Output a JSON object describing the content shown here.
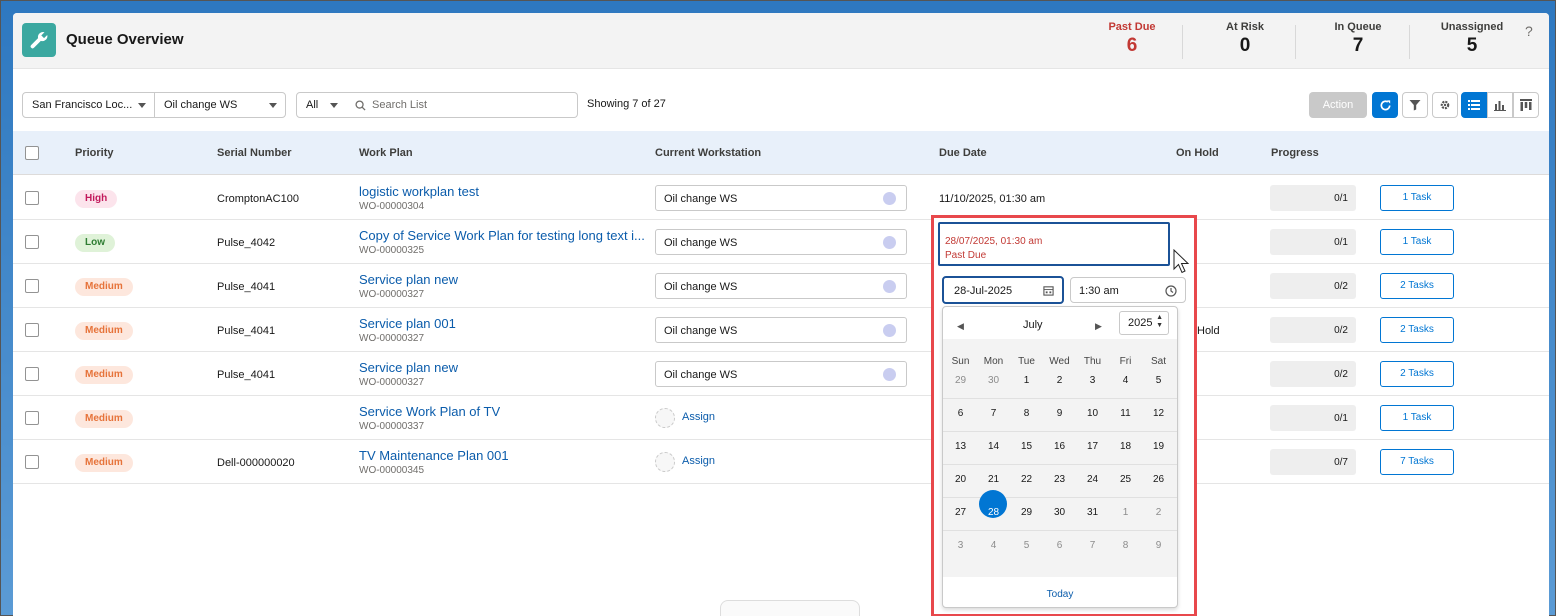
{
  "header": {
    "title": "Queue Overview",
    "stats": [
      {
        "label": "Past Due",
        "value": "6"
      },
      {
        "label": "At Risk",
        "value": "0"
      },
      {
        "label": "In Queue",
        "value": "7"
      },
      {
        "label": "Unassigned",
        "value": "5"
      }
    ],
    "help": "?"
  },
  "toolbar": {
    "location": "San Francisco Loc...",
    "workstation": "Oil change WS",
    "filter": "All",
    "search_placeholder": "Search List",
    "showing": "Showing 7 of 27",
    "action": "Action"
  },
  "table": {
    "headers": [
      "Priority",
      "Serial Number",
      "Work Plan",
      "Current Workstation",
      "Due Date",
      "On Hold",
      "Progress"
    ],
    "rows": [
      {
        "priority": "High",
        "serial": "CromptonAC100",
        "plan": "logistic workplan test",
        "wo": "WO-00000304",
        "ws": "Oil change WS",
        "due": "11/10/2025, 01:30 am",
        "hold": "",
        "progress": "0/1",
        "tasks": "1 Task"
      },
      {
        "priority": "Low",
        "serial": "Pulse_4042",
        "plan": "Copy of Service Work Plan for testing long text i...",
        "wo": "WO-00000325",
        "ws": "Oil change WS",
        "due": "",
        "hold": "",
        "progress": "0/1",
        "tasks": "1 Task"
      },
      {
        "priority": "Medium",
        "serial": "Pulse_4041",
        "plan": "Service plan new",
        "wo": "WO-00000327",
        "ws": "Oil change WS",
        "due": "",
        "hold": "",
        "progress": "0/2",
        "tasks": "2 Tasks"
      },
      {
        "priority": "Medium",
        "serial": "Pulse_4041",
        "plan": "Service plan 001",
        "wo": "WO-00000327",
        "ws": "Oil change WS",
        "due": "",
        "hold": "Hold",
        "progress": "0/2",
        "tasks": "2 Tasks"
      },
      {
        "priority": "Medium",
        "serial": "Pulse_4041",
        "plan": "Service plan new",
        "wo": "WO-00000327",
        "ws": "Oil change WS",
        "due": "",
        "hold": "",
        "progress": "0/2",
        "tasks": "2 Tasks"
      },
      {
        "priority": "Medium",
        "serial": "",
        "plan": "Service Work Plan of TV",
        "wo": "WO-00000337",
        "ws": "",
        "assign": "Assign",
        "due": "",
        "hold": "",
        "progress": "0/1",
        "tasks": "1 Task"
      },
      {
        "priority": "Medium",
        "serial": "Dell-000000020",
        "plan": "TV Maintenance Plan 001",
        "wo": "WO-00000345",
        "ws": "",
        "assign": "Assign",
        "due": "",
        "hold": "",
        "progress": "0/7",
        "tasks": "7 Tasks"
      }
    ]
  },
  "popover": {
    "due_value": "28/07/2025, 01:30 am",
    "due_status": "Past Due",
    "date_value": "28-Jul-2025",
    "time_value": "1:30 am",
    "month": "July",
    "year": "2025",
    "days_of_week": [
      "Sun",
      "Mon",
      "Tue",
      "Wed",
      "Thu",
      "Fri",
      "Sat"
    ],
    "weeks": [
      [
        "29",
        "30",
        "1",
        "2",
        "3",
        "4",
        "5"
      ],
      [
        "6",
        "7",
        "8",
        "9",
        "10",
        "11",
        "12"
      ],
      [
        "13",
        "14",
        "15",
        "16",
        "17",
        "18",
        "19"
      ],
      [
        "20",
        "21",
        "22",
        "23",
        "24",
        "25",
        "26"
      ],
      [
        "27",
        "28",
        "29",
        "30",
        "31",
        "1",
        "2"
      ],
      [
        "3",
        "4",
        "5",
        "6",
        "7",
        "8",
        "9"
      ]
    ],
    "selected": "28",
    "today": "Today"
  },
  "colors": {
    "accent": "#0176d3",
    "past_due": "#c23934",
    "highlight_border": "#e8484c"
  }
}
